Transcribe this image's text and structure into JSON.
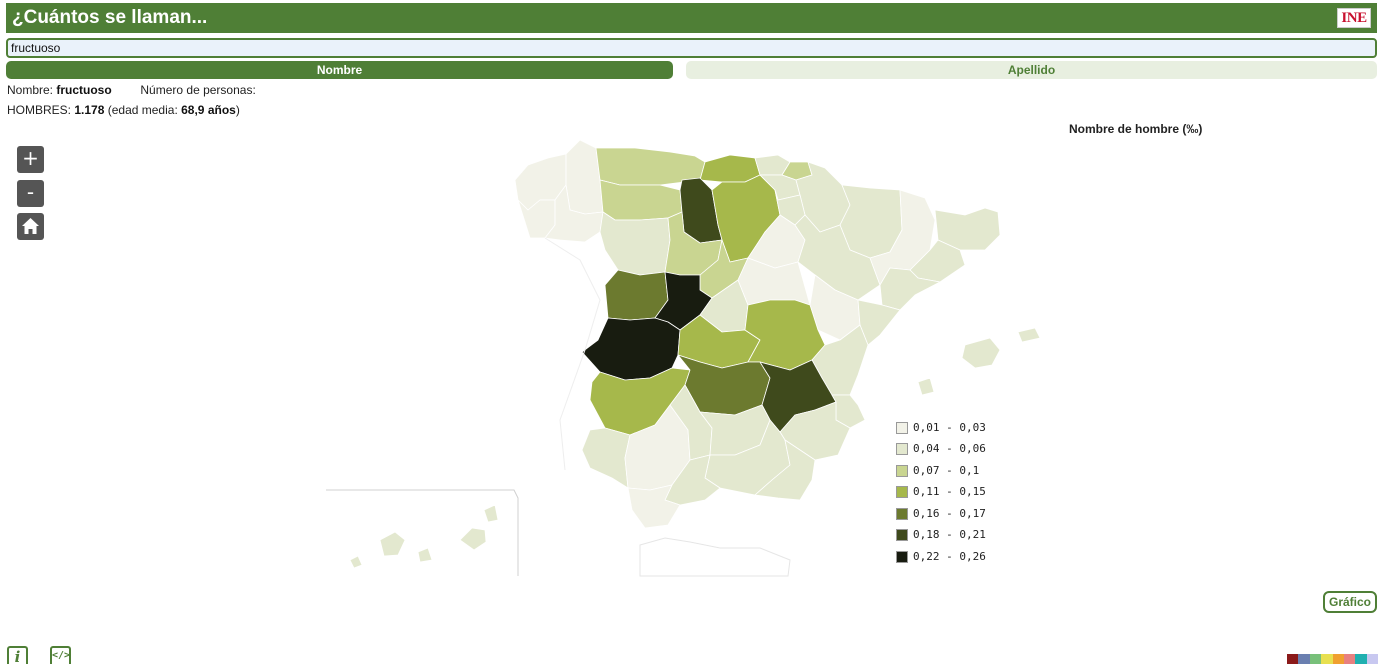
{
  "header": {
    "title": "¿Cuántos se llaman...",
    "logo_text": "INE"
  },
  "search": {
    "value": "fructuoso"
  },
  "tabs": [
    {
      "label": "Nombre",
      "active": true
    },
    {
      "label": "Apellido",
      "active": false
    }
  ],
  "info": {
    "name_label": "Nombre:",
    "name_value": "fructuoso",
    "persons_label": "Número de personas:",
    "men_label": "HOMBRES:",
    "men_value": "1.178",
    "age_prefix": "(edad media:",
    "age_value": "68,9 años",
    "age_suffix": ")"
  },
  "map_controls": {
    "zoom_in": "+",
    "zoom_out": "-",
    "home_icon": "home-icon"
  },
  "legend": {
    "title": "Nombre de hombre (‰)",
    "items": [
      {
        "label": "0,01 - 0,03",
        "color": "#f2f2e8"
      },
      {
        "label": "0,04 - 0,06",
        "color": "#e3e8cf"
      },
      {
        "label": "0,07 - 0,1",
        "color": "#c9d591"
      },
      {
        "label": "0,11 - 0,15",
        "color": "#a6b84b"
      },
      {
        "label": "0,16 - 0,17",
        "color": "#6c7a2f"
      },
      {
        "label": "0,18 - 0,21",
        "color": "#3f4a1c"
      },
      {
        "label": "0,22 - 0,26",
        "color": "#181c10"
      }
    ]
  },
  "map": {
    "regions": [
      {
        "name": "a-coruna",
        "class": 0
      },
      {
        "name": "lugo",
        "class": 0
      },
      {
        "name": "pontevedra",
        "class": 0
      },
      {
        "name": "ourense",
        "class": 0
      },
      {
        "name": "asturias",
        "class": 2
      },
      {
        "name": "leon",
        "class": 2
      },
      {
        "name": "zamora",
        "class": 3
      },
      {
        "name": "palencia",
        "class": 5
      },
      {
        "name": "valladolid",
        "class": 3
      },
      {
        "name": "cantabria",
        "class": 1
      },
      {
        "name": "burgos",
        "class": 2
      },
      {
        "name": "bizkaia",
        "class": 1
      },
      {
        "name": "gipuzkoa",
        "class": 1
      },
      {
        "name": "araba",
        "class": 1
      },
      {
        "name": "navarra",
        "class": 1
      },
      {
        "name": "la-rioja",
        "class": 2
      },
      {
        "name": "soria",
        "class": 0
      },
      {
        "name": "segovia",
        "class": 2
      },
      {
        "name": "salamanca",
        "class": 4
      },
      {
        "name": "avila",
        "class": 6
      },
      {
        "name": "huesca",
        "class": 1
      },
      {
        "name": "zaragoza",
        "class": 1
      },
      {
        "name": "teruel",
        "class": 0
      },
      {
        "name": "lleida",
        "class": 0
      },
      {
        "name": "girona",
        "class": 1
      },
      {
        "name": "barcelona",
        "class": 1
      },
      {
        "name": "tarragona",
        "class": 1
      },
      {
        "name": "madrid",
        "class": 1
      },
      {
        "name": "guadalajara",
        "class": 0
      },
      {
        "name": "caceres",
        "class": 6
      },
      {
        "name": "toledo",
        "class": 3
      },
      {
        "name": "cuenca",
        "class": 3
      },
      {
        "name": "castellon",
        "class": 1
      },
      {
        "name": "valencia",
        "class": 1
      },
      {
        "name": "badajoz",
        "class": 3
      },
      {
        "name": "ciudad-real",
        "class": 4
      },
      {
        "name": "albacete",
        "class": 5
      },
      {
        "name": "alicante",
        "class": 1
      },
      {
        "name": "murcia",
        "class": 1
      },
      {
        "name": "huelva",
        "class": 1
      },
      {
        "name": "sevilla",
        "class": 0
      },
      {
        "name": "cordoba",
        "class": 1
      },
      {
        "name": "jaen",
        "class": 1
      },
      {
        "name": "granada",
        "class": 1
      },
      {
        "name": "almeria",
        "class": 1
      },
      {
        "name": "malaga",
        "class": 1
      },
      {
        "name": "cadiz",
        "class": 0
      },
      {
        "name": "mallorca",
        "class": 1
      },
      {
        "name": "menorca",
        "class": 1
      },
      {
        "name": "ibiza",
        "class": 1
      },
      {
        "name": "canarias-las-palmas",
        "class": 1
      },
      {
        "name": "canarias-santa-cruz",
        "class": 1
      }
    ]
  },
  "grafico_button": "Gráfico",
  "footer": {
    "info_icon": "i",
    "embed_icon": "</>",
    "palette": [
      "#8b1a1a",
      "#6a7fb0",
      "#78c07a",
      "#e8e050",
      "#f0a030",
      "#e88080",
      "#20b0b0",
      "#c8c8f0"
    ]
  }
}
